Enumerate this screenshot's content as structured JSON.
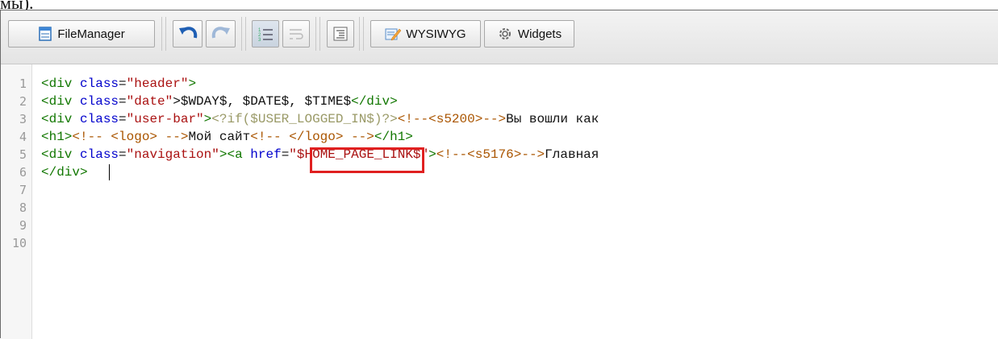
{
  "page": {
    "top_fragment": "мы)."
  },
  "toolbar": {
    "filemanager_label": "FileManager",
    "wysiwyg_label": "WYSIWYG",
    "widgets_label": "Widgets",
    "icon_names": [
      "file-icon",
      "undo-icon",
      "redo-icon",
      "list-icon",
      "wrap-icon",
      "indent-icon",
      "edit-icon",
      "gear-icon"
    ]
  },
  "gutter": {
    "numbers": [
      "1",
      "2",
      "3",
      "4",
      "5",
      "6",
      "7",
      "8",
      "9",
      "10"
    ]
  },
  "code": {
    "l1": {
      "open": "<div ",
      "attr": "class",
      "eq": "=",
      "val": "\"header\"",
      "close": ">"
    },
    "l2": {
      "open": "<div ",
      "attr": "class",
      "eq": "=",
      "val": "\"date\"",
      "text": ">$WDAY$, $DATE$, $TIME$",
      "end": "</div>"
    },
    "l3": {
      "open": "<div ",
      "attr": "class",
      "eq": "=",
      "val": "\"user-bar\"",
      "gt": ">",
      "php": "<?if($USER_LOGGED_IN$)?>",
      "cm": "<!--<s5200>-->",
      "text": "Вы вошли как"
    },
    "l4": {
      "open": "<h1>",
      "cm1": "<!-- <logo> -->",
      "text": "Мой сайт",
      "cm2": "<!-- </logo> -->",
      "end": "</h1>"
    },
    "l5": {
      "open": "<div ",
      "attr": "class",
      "eq": "=",
      "val": "\"navigation\"",
      "gt": ">",
      "a": "<a ",
      "href": "href",
      "eq2": "=",
      "hval": "\"$HOME_PAGE_LINK$\"",
      "gt2": ">",
      "cm": "<!--<s5176>-->",
      "text": "Главная"
    },
    "l6": {
      "end": "</div>"
    }
  },
  "colors": {
    "tag": "#117700",
    "attr": "#0000cc",
    "string": "#aa1111",
    "comment": "#aa5500",
    "highlight": "#e02020"
  }
}
